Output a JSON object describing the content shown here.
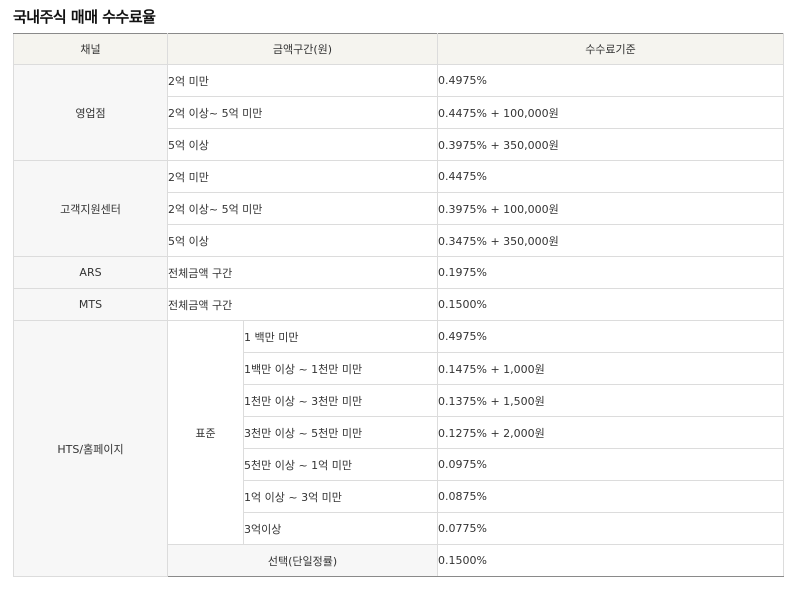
{
  "page_title": "국내주식 매매 수수료율",
  "table": {
    "headers": [
      "채널",
      "금액구간(원)",
      "수수료기준"
    ],
    "branch": {
      "channel": "영업점",
      "rows": [
        {
          "range": "2억 미만",
          "fee": "0.4975%"
        },
        {
          "range": "2억 이상~ 5억 미만",
          "fee": "0.4475% + 100,000원"
        },
        {
          "range": "5억 이상",
          "fee": "0.3975% + 350,000원"
        }
      ]
    },
    "support_center": {
      "channel": "고객지원센터",
      "rows": [
        {
          "range": "2억 미만",
          "fee": "0.4475%"
        },
        {
          "range": "2억 이상~ 5억 미만",
          "fee": "0.3975% + 100,000원"
        },
        {
          "range": "5억 이상",
          "fee": "0.3475% + 350,000원"
        }
      ]
    },
    "ars": {
      "channel": "ARS",
      "range": "전체금액 구간",
      "fee": "0.1975%"
    },
    "mts": {
      "channel": "MTS",
      "range": "전체금액 구간",
      "fee": "0.1500%"
    },
    "hts": {
      "channel": "HTS/홈페이지",
      "standard_label": "표준",
      "standard_rows": [
        {
          "range": "1 백만 미만",
          "fee": "0.4975%"
        },
        {
          "range": "1백만 이상 ~ 1천만 미만",
          "fee": "0.1475% + 1,000원"
        },
        {
          "range": "1천만 이상 ~ 3천만 미만",
          "fee": "0.1375% + 1,500원"
        },
        {
          "range": "3천만 이상 ~ 5천만 미만",
          "fee": "0.1275% + 2,000원"
        },
        {
          "range": "5천만 이상 ~ 1억 미만",
          "fee": "0.0975%"
        },
        {
          "range": "1억 이상 ~ 3억 미만",
          "fee": "0.0875%"
        },
        {
          "range": "3억이상",
          "fee": "0.0775%"
        }
      ],
      "select_label": "선택(단일정률)",
      "select_fee": "0.1500%"
    }
  }
}
